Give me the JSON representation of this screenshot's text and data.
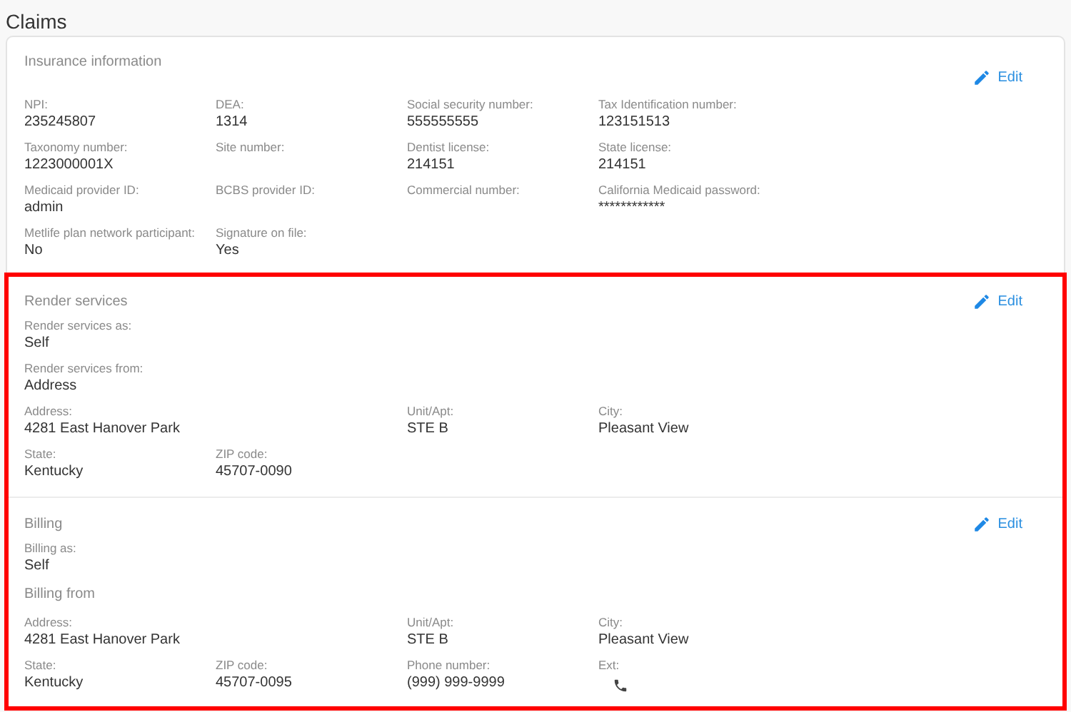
{
  "page_title": "Claims",
  "sections": [
    {
      "title": "Insurance information",
      "edit": "Edit",
      "highlighted": false,
      "rows": [
        [
          {
            "kind": "field",
            "label": "NPI:",
            "value": "235245807"
          },
          {
            "kind": "field",
            "label": "DEA:",
            "value": "1314"
          },
          {
            "kind": "field",
            "label": "Social security number:",
            "value": "555555555"
          },
          {
            "kind": "field",
            "label": "Tax Identification number:",
            "value": "123151513"
          }
        ],
        [
          {
            "kind": "field",
            "label": "Taxonomy number:",
            "value": "1223000001X"
          },
          {
            "kind": "field",
            "label": "Site number:"
          },
          {
            "kind": "field",
            "label": "Dentist license:",
            "value": "214151"
          },
          {
            "kind": "field",
            "label": "State license:",
            "value": "214151"
          }
        ],
        [
          {
            "kind": "field",
            "label": "Medicaid provider ID:",
            "value": "admin"
          },
          {
            "kind": "field",
            "label": "BCBS provider ID:"
          },
          {
            "kind": "field",
            "label": "Commercial number:"
          },
          {
            "kind": "field",
            "label": "California Medicaid password:",
            "value": "************"
          }
        ],
        [
          {
            "kind": "field",
            "label": "Metlife plan network participant:",
            "value": "No"
          },
          {
            "kind": "field",
            "label": "Signature on file:",
            "value": "Yes"
          }
        ]
      ]
    },
    {
      "title": "Render services",
      "edit": "Edit",
      "highlighted": true,
      "rows": [
        [
          {
            "kind": "field",
            "label": "Render services as:",
            "value": "Self"
          }
        ],
        [
          {
            "kind": "field",
            "label": "Render services from:",
            "value": "Address"
          }
        ],
        [
          {
            "kind": "field",
            "label": "Address:",
            "value": "4281 East Hanover Park"
          },
          null,
          {
            "kind": "field",
            "label": "Unit/Apt:",
            "value": "STE B"
          },
          {
            "kind": "field",
            "label": "City:",
            "value": "Pleasant View"
          }
        ],
        [
          {
            "kind": "field",
            "label": "State:",
            "value": "Kentucky"
          },
          {
            "kind": "field",
            "label": "ZIP code:",
            "value": "45707-0090"
          }
        ]
      ]
    },
    {
      "title": "Billing",
      "edit": "Edit",
      "highlighted": true,
      "rows": [
        [
          {
            "kind": "field",
            "label": "Billing as:",
            "value": "Self"
          }
        ],
        [
          {
            "kind": "heading",
            "label": "Billing from"
          }
        ],
        [
          {
            "kind": "field",
            "label": "Address:",
            "value": "4281 East Hanover Park"
          },
          null,
          {
            "kind": "field",
            "label": "Unit/Apt:",
            "value": "STE B"
          },
          {
            "kind": "field",
            "label": "City:",
            "value": "Pleasant View"
          }
        ],
        [
          {
            "kind": "field",
            "label": "State:",
            "value": "Kentucky"
          },
          {
            "kind": "field",
            "label": "ZIP code:",
            "value": "45707-0095"
          },
          {
            "kind": "field",
            "label": "Phone number:",
            "value": "(999) 999-9999"
          },
          {
            "kind": "phone",
            "label": "Ext:"
          }
        ]
      ]
    }
  ]
}
